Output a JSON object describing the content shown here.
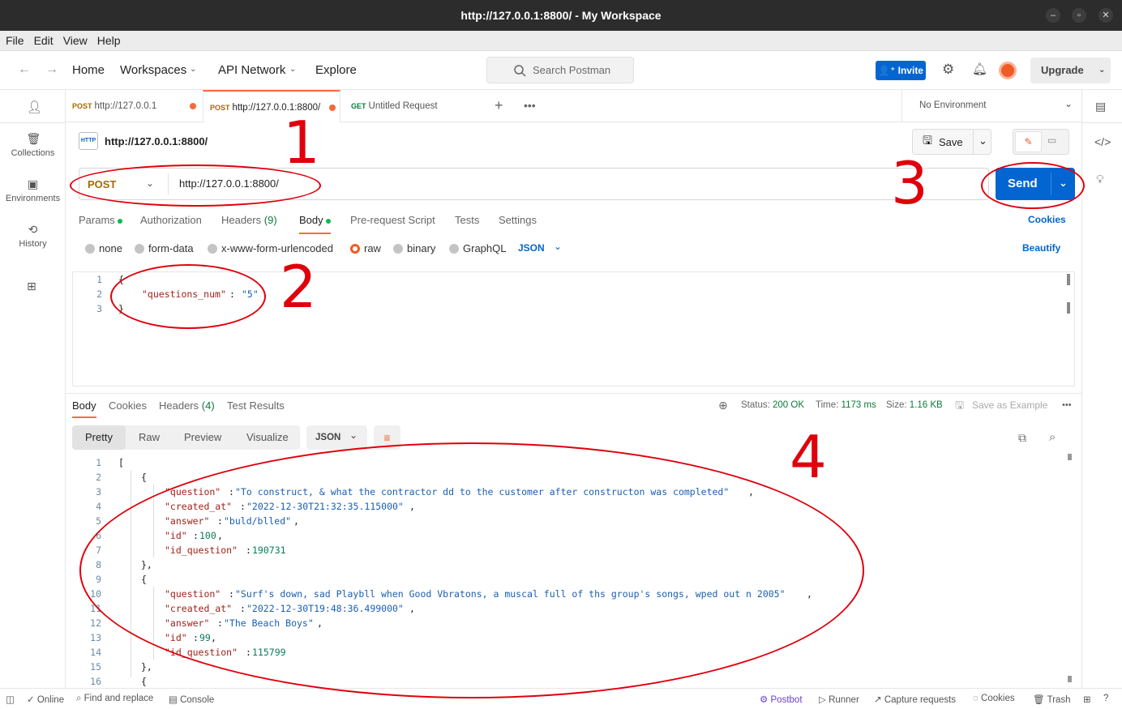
{
  "window": {
    "title": "http://127.0.0.1:8800/ - My Workspace"
  },
  "menu": [
    "File",
    "Edit",
    "View",
    "Help"
  ],
  "nav": {
    "home": "Home",
    "workspaces": "Workspaces",
    "api_network": "API Network",
    "explore": "Explore",
    "search_placeholder": "Search Postman",
    "invite": "Invite",
    "upgrade": "Upgrade"
  },
  "sidebar": {
    "collections": "Collections",
    "environments": "Environments",
    "history": "History"
  },
  "tabs": [
    {
      "method": "POST",
      "label": "http://127.0.0.1"
    },
    {
      "method": "POST",
      "label": "http://127.0.0.1:8800/"
    },
    {
      "method": "GET",
      "label": "Untitled Request"
    }
  ],
  "environment": "No Environment",
  "request": {
    "title": "http://127.0.0.1:8800/",
    "save": "Save",
    "method": "POST",
    "url": "http://127.0.0.1:8800/",
    "send": "Send",
    "tabs": {
      "params": "Params",
      "authorization": "Authorization",
      "headers": "Headers",
      "headers_count": "(9)",
      "body": "Body",
      "prerequest": "Pre-request Script",
      "tests": "Tests",
      "settings": "Settings",
      "cookies": "Cookies"
    },
    "body_types": {
      "none": "none",
      "form_data": "form-data",
      "urlencoded": "x-www-form-urlencoded",
      "raw": "raw",
      "binary": "binary",
      "graphql": "GraphQL",
      "format": "JSON",
      "beautify": "Beautify"
    },
    "body_lines": [
      "1",
      "2",
      "3"
    ],
    "body_brace_open": "{",
    "body_key": "\"questions_num\"",
    "body_value": "\"5\"",
    "body_brace_close": "}"
  },
  "response": {
    "tabs": {
      "body": "Body",
      "cookies": "Cookies",
      "headers": "Headers",
      "headers_count": "(4)",
      "tests": "Test Results"
    },
    "status_label": "Status:",
    "status": "200 OK",
    "time_label": "Time:",
    "time": "1173 ms",
    "size_label": "Size:",
    "size": "1.16 KB",
    "save_example": "Save as Example",
    "views": {
      "pretty": "Pretty",
      "raw": "Raw",
      "preview": "Preview",
      "visualize": "Visualize",
      "format": "JSON"
    },
    "line_numbers": [
      "1",
      "2",
      "3",
      "4",
      "5",
      "6",
      "7",
      "8",
      "9",
      "10",
      "11",
      "12",
      "13",
      "14",
      "15",
      "16"
    ],
    "items": [
      {
        "question": "\"To construct, & what the contractor dd to the customer after constructon was completed\"",
        "created_at": "\"2022-12-30T21:32:35.115000\"",
        "answer": "\"buld/blled\"",
        "id": "100",
        "id_question": "190731"
      },
      {
        "question": "\"Surf's down, sad Playbll when Good Vbratons, a muscal full of ths group's songs, wped out n 2005\"",
        "created_at": "\"2022-12-30T19:48:36.499000\"",
        "answer": "\"The Beach Boys\"",
        "id": "99",
        "id_question": "115799"
      }
    ]
  },
  "statusbar": {
    "online": "Online",
    "find": "Find and replace",
    "console": "Console",
    "postbot": "Postbot",
    "runner": "Runner",
    "capture": "Capture requests",
    "cookies": "Cookies",
    "trash": "Trash"
  },
  "annotations": [
    "1",
    "2",
    "3",
    "4"
  ],
  "colors": {
    "accent": "#ff6c37",
    "primary": "#0265d2",
    "annotation": "#e0000c"
  }
}
